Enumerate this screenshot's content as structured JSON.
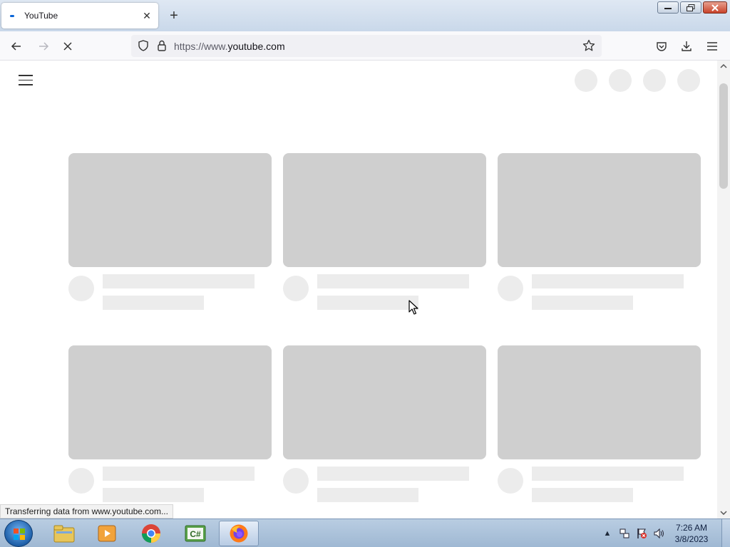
{
  "browser": {
    "tab": {
      "title": "YouTube",
      "close_icon": "close-icon"
    },
    "new_tab_icon": "plus-icon",
    "url": {
      "scheme": "https://www.",
      "host": "youtube.com"
    },
    "status_text": "Transferring data from www.youtube.com..."
  },
  "page": {
    "menu_icon": "hamburger-icon",
    "state": "loading-skeleton",
    "cards_visible": 6
  },
  "taskbar": {
    "clock_time": "7:26 AM",
    "clock_date": "3/8/2023",
    "pinned": [
      "windows-explorer",
      "media-player",
      "chrome",
      "csharp-editor",
      "firefox"
    ],
    "active": "firefox"
  },
  "colors": {
    "skeleton_thumb": "#cfcfcf",
    "skeleton_text": "#ececec",
    "taskbar": "#b9cde2",
    "close_button": "#c9432a"
  }
}
